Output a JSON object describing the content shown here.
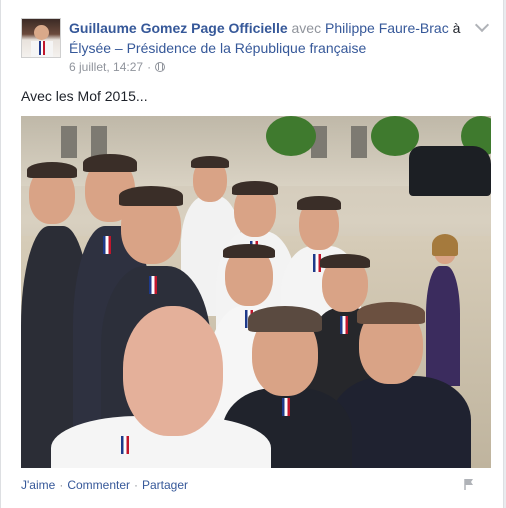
{
  "post": {
    "author": "Guillaume Gomez Page Officielle",
    "with_word": "avec",
    "tagged_person": "Philippe Faure-Brac",
    "at_word": "à",
    "place": "Élysée – Présidence de la République française",
    "date": "6 juillet, 14:27",
    "meta_sep": "·",
    "privacy_icon": "globe-icon",
    "caption": "Avec les Mof 2015..."
  },
  "actions": {
    "like": "J'aime",
    "comment": "Commenter",
    "share": "Partager",
    "separator": "·",
    "flag_icon": "flag-icon"
  },
  "colors": {
    "link": "#365899",
    "meta": "#90949c",
    "text": "#1d2129"
  }
}
